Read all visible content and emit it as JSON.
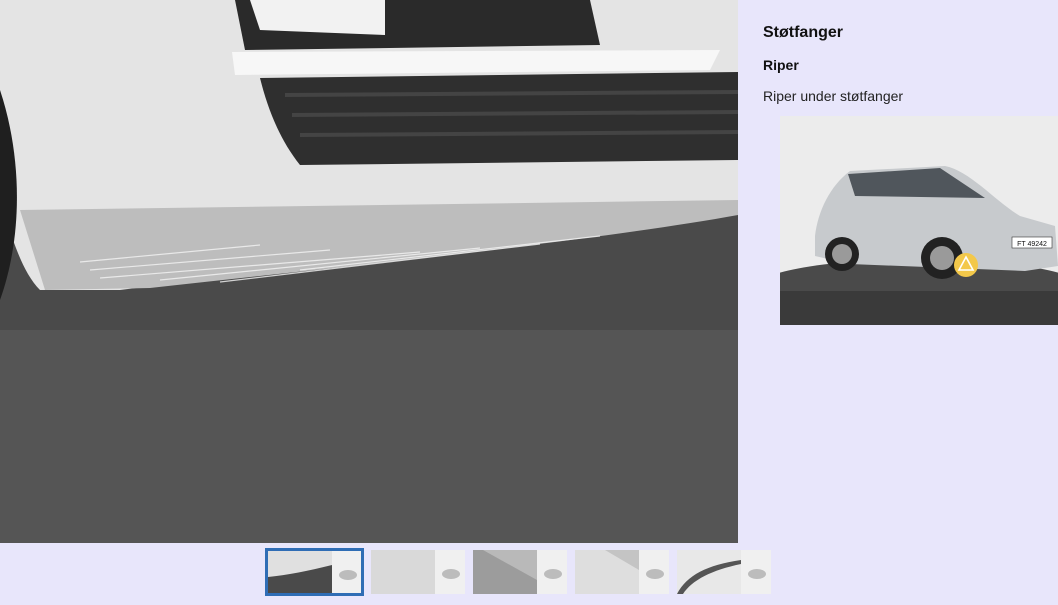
{
  "main_photo": {
    "icon": "damage-closeup-photo",
    "description": ""
  },
  "sidebar": {
    "title": "Støtfanger",
    "damage_type": "Riper",
    "description": "Riper under støtfanger"
  },
  "overview": {
    "icon": "car-overview-photo",
    "plate": "FT 49242",
    "marker_icon": "warning-marker-icon",
    "marker_color": "#f3c84a"
  },
  "thumbnails": {
    "count": 5,
    "active_index": 0,
    "active_border_color": "#2f6db5"
  },
  "colors": {
    "background": "#e8e6fb",
    "accent": "#2f6db5"
  }
}
